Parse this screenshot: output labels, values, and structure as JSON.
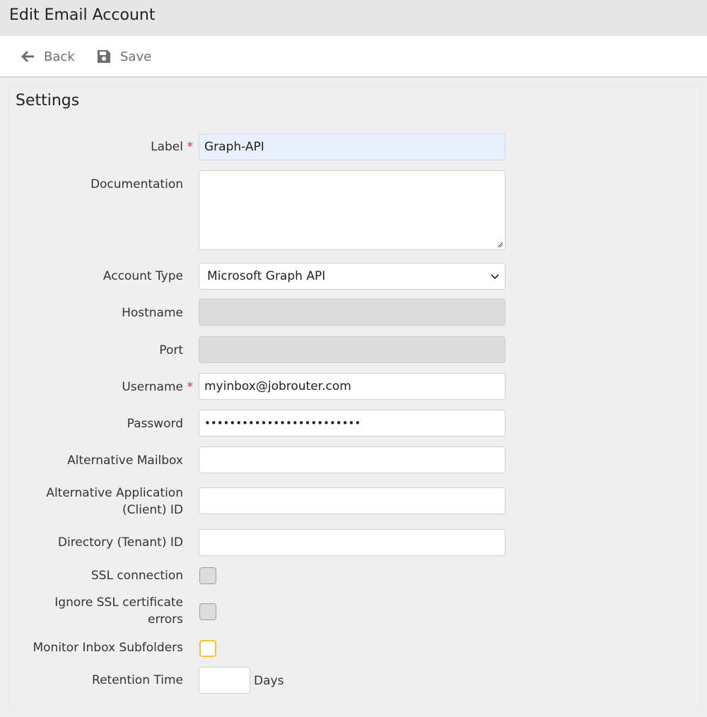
{
  "window": {
    "title": "Edit Email Account"
  },
  "toolbar": {
    "back_label": "Back",
    "save_label": "Save",
    "back_icon": "arrow-left-icon",
    "save_icon": "floppy-disk-icon"
  },
  "panel": {
    "title": "Settings"
  },
  "form": {
    "label": {
      "label": "Label",
      "required": "*",
      "value": "Graph-API"
    },
    "documentation": {
      "label": "Documentation",
      "value": ""
    },
    "account_type": {
      "label": "Account Type",
      "value": "Microsoft Graph API"
    },
    "hostname": {
      "label": "Hostname",
      "value": ""
    },
    "port": {
      "label": "Port",
      "value": ""
    },
    "username": {
      "label": "Username",
      "required": "*",
      "value": "myinbox@jobrouter.com"
    },
    "password": {
      "label": "Password",
      "value": "•••••••••••••••••••••••••"
    },
    "alternative_mailbox": {
      "label": "Alternative Mailbox",
      "value": ""
    },
    "alternative_application_id": {
      "label_line1": "Alternative Application",
      "label_line2": "(Client) ID",
      "value": ""
    },
    "directory_id": {
      "label": "Directory (Tenant) ID",
      "value": ""
    },
    "ssl_connection": {
      "label": "SSL connection",
      "checked": false
    },
    "ignore_ssl_errors": {
      "label_line1": "Ignore SSL certificate",
      "label_line2": "errors",
      "checked": false
    },
    "monitor_subfolders": {
      "label": "Monitor Inbox Subfolders",
      "checked": false
    },
    "retention_time": {
      "label": "Retention Time",
      "value": "",
      "unit": "Days"
    }
  },
  "colors": {
    "required": "#d32f2f",
    "highlight_field": "#e8f0fe",
    "focus_checkbox": "#f2c230",
    "disabled_field": "#dcdcdc"
  }
}
